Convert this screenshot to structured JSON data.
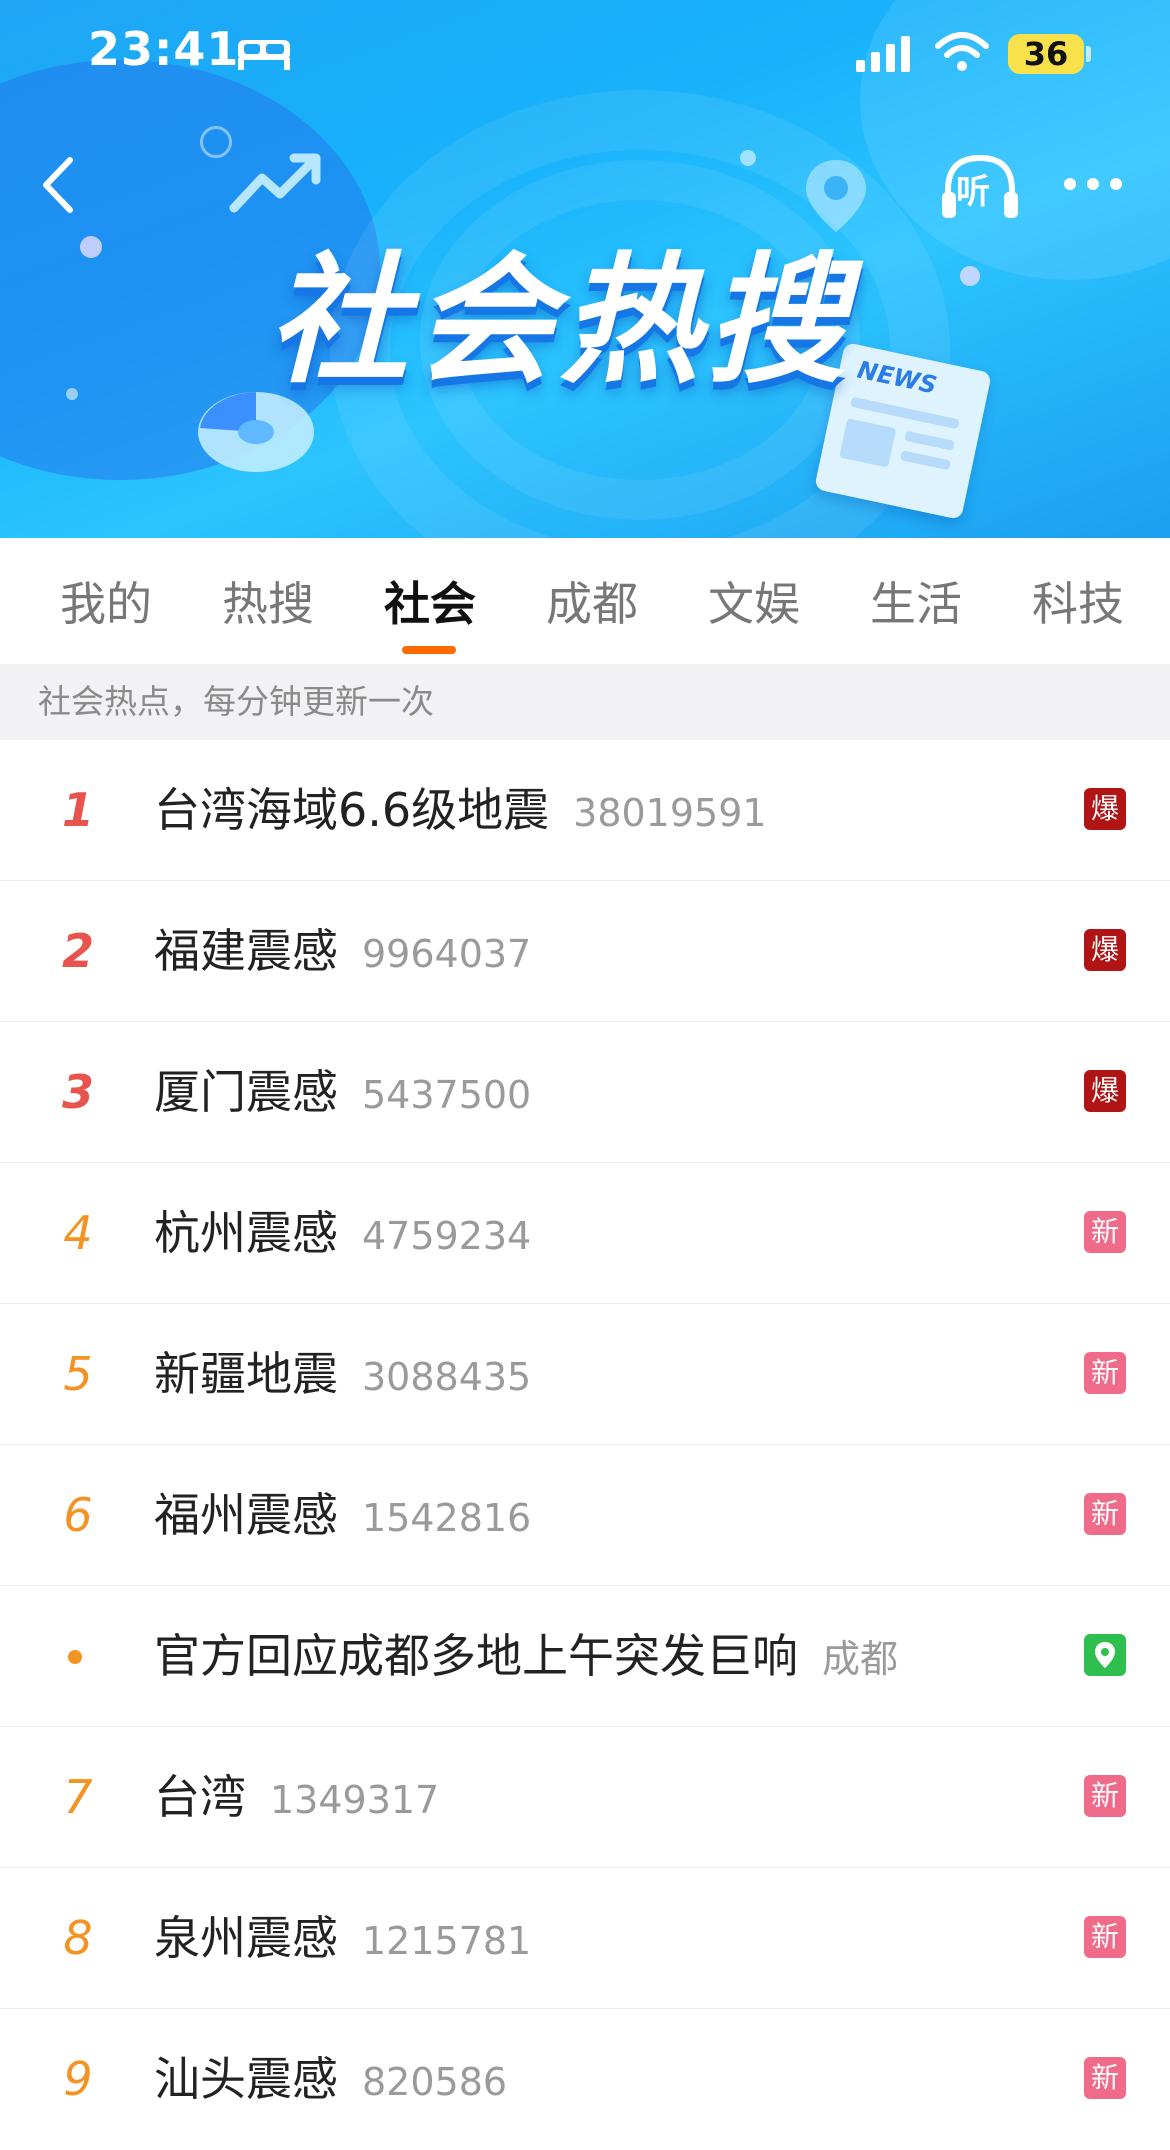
{
  "status_bar": {
    "time": "23:41",
    "battery": "36"
  },
  "header": {
    "title": "社会热搜",
    "listen_label": "听",
    "news_label": "NEWS"
  },
  "tabs": [
    {
      "label": "我的"
    },
    {
      "label": "热搜"
    },
    {
      "label": "社会"
    },
    {
      "label": "成都"
    },
    {
      "label": "文娱"
    },
    {
      "label": "生活"
    },
    {
      "label": "科技"
    }
  ],
  "active_tab": "社会",
  "subheader": "社会热点，每分钟更新一次",
  "items": [
    {
      "rank": "1",
      "title": "台湾海域6.6级地震",
      "count": "38019591",
      "badge": "爆",
      "badge_type": "hot"
    },
    {
      "rank": "2",
      "title": "福建震感",
      "count": "9964037",
      "badge": "爆",
      "badge_type": "hot"
    },
    {
      "rank": "3",
      "title": "厦门震感",
      "count": "5437500",
      "badge": "爆",
      "badge_type": "hot"
    },
    {
      "rank": "4",
      "title": "杭州震感",
      "count": "4759234",
      "badge": "新",
      "badge_type": "new"
    },
    {
      "rank": "5",
      "title": "新疆地震",
      "count": "3088435",
      "badge": "新",
      "badge_type": "new"
    },
    {
      "rank": "6",
      "title": "福州震感",
      "count": "1542816",
      "badge": "新",
      "badge_type": "new"
    },
    {
      "rank": "",
      "title": "官方回应成都多地上午突发巨响",
      "count": "成都",
      "badge": "",
      "badge_type": "loc"
    },
    {
      "rank": "7",
      "title": "台湾",
      "count": "1349317",
      "badge": "新",
      "badge_type": "new"
    },
    {
      "rank": "8",
      "title": "泉州震感",
      "count": "1215781",
      "badge": "新",
      "badge_type": "new"
    },
    {
      "rank": "9",
      "title": "汕头震感",
      "count": "820586",
      "badge": "新",
      "badge_type": "new"
    }
  ],
  "colors": {
    "banner": "#17b2fb",
    "accent": "#ff6a00",
    "rank_top": "#e8534e",
    "rank_mid": "#f29322",
    "badge_hot": "#b01414",
    "badge_new": "#f06a8a",
    "badge_loc": "#2fbf4f"
  }
}
